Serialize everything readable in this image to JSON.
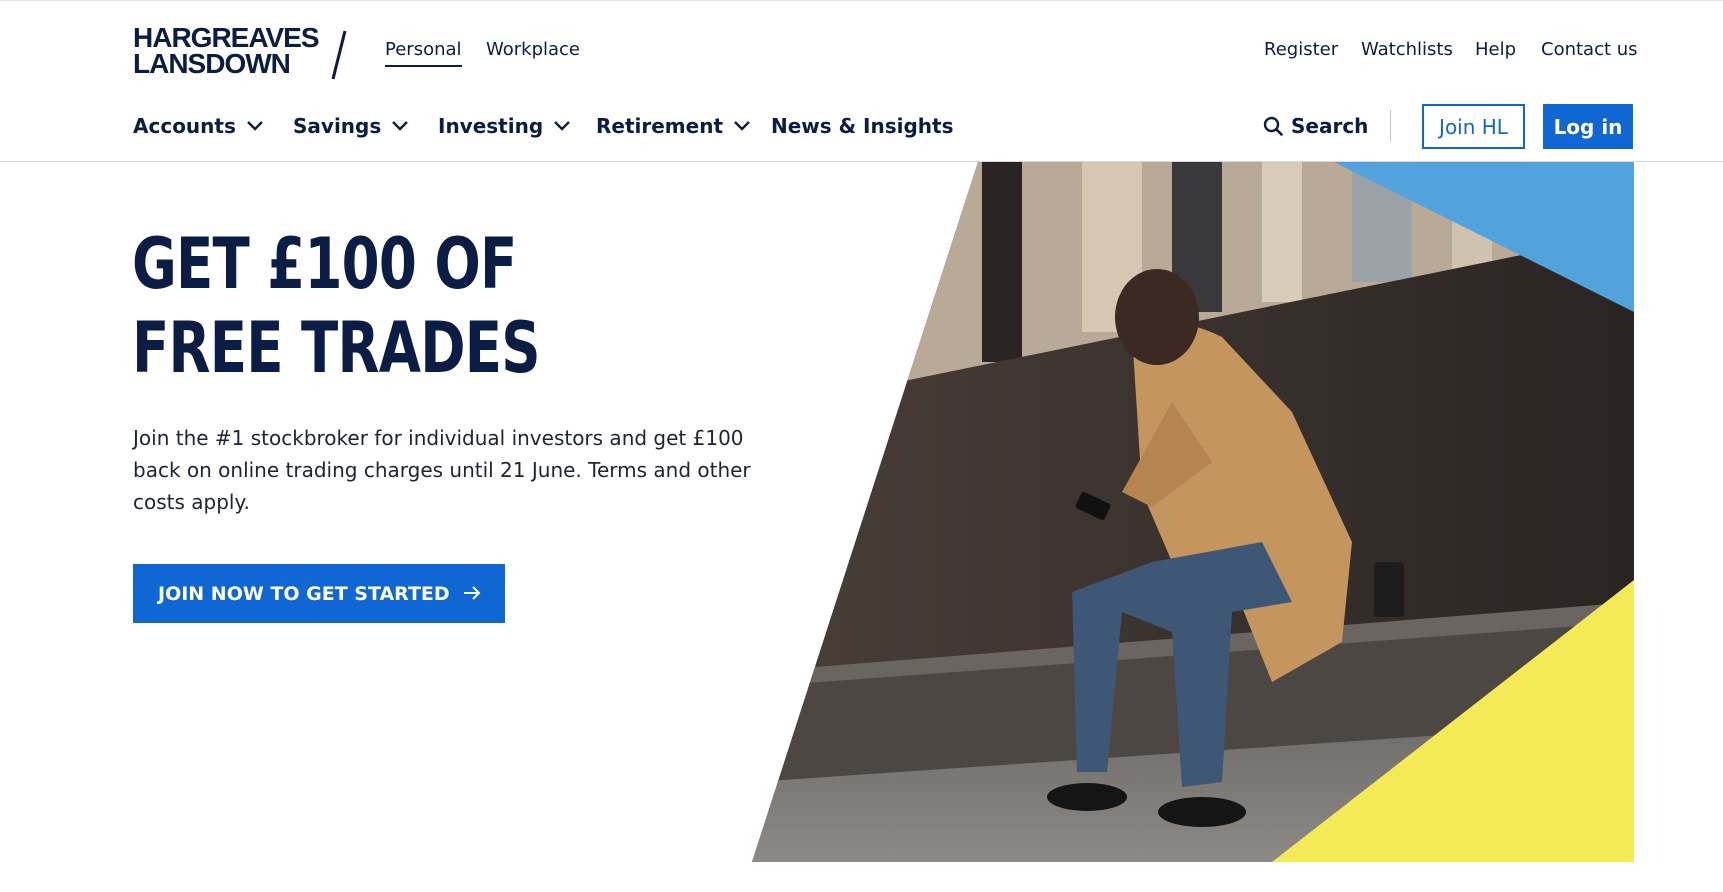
{
  "brand": {
    "line1": "HARGREAVES",
    "line2": "LANSDOWN",
    "color": "#0b1d45"
  },
  "audience_tabs": [
    {
      "label": "Personal",
      "active": true
    },
    {
      "label": "Workplace",
      "active": false
    }
  ],
  "utility_nav": {
    "register": "Register",
    "watchlists": "Watchlists",
    "help": "Help",
    "contact": "Contact us"
  },
  "main_nav": {
    "accounts": "Accounts",
    "savings": "Savings",
    "investing": "Investing",
    "retirement": "Retirement",
    "news": "News & Insights"
  },
  "header_actions": {
    "search_label": "Search",
    "join_label": "Join HL",
    "login_label": "Log in"
  },
  "hero": {
    "title_line1": "GET £100 OF",
    "title_line2": "FREE TRADES",
    "body": "Join the #1 stockbroker for individual investors and get £100 back on online trading charges until 21 June. Terms and other costs apply.",
    "cta_label": "JOIN NOW TO GET STARTED"
  },
  "colors": {
    "accent_blue": "#1066d3",
    "navy": "#0b1d45",
    "sky_triangle": "#52a3dd",
    "yellow_triangle": "#f4ea55"
  }
}
